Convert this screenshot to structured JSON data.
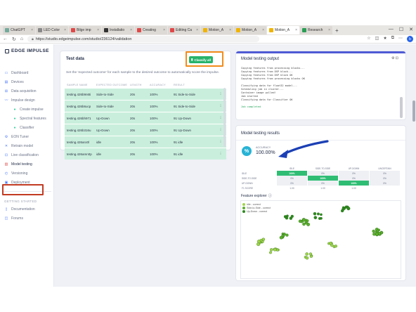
{
  "browser": {
    "tabs": [
      {
        "label": "ChatGPT",
        "color": "#74aa9c",
        "active": false
      },
      {
        "label": "LED Color",
        "color": "#888888",
        "active": false
      },
      {
        "label": "Bilge imp",
        "color": "#e04848",
        "active": false
      },
      {
        "label": "Installatio",
        "color": "#333333",
        "active": false
      },
      {
        "label": "Creating",
        "color": "#e04848",
        "active": false
      },
      {
        "label": "Editing Ca",
        "color": "#e04848",
        "active": false
      },
      {
        "label": "Motion_A",
        "color": "#f0b400",
        "active": false
      },
      {
        "label": "Motion_A",
        "color": "#f0b400",
        "active": false
      },
      {
        "label": "Motion_A",
        "color": "#f0b400",
        "active": true
      },
      {
        "label": "Research",
        "color": "#2a9d55",
        "active": false
      }
    ],
    "url": "https://studio.edgeimpulse.com/studio/236124/validation",
    "controls": {
      "minimize": "—",
      "maximize": "☐",
      "close": "✕"
    }
  },
  "sidebar": {
    "logo": "EDGE IMPULSE",
    "items": [
      {
        "label": "Dashboard",
        "icon": "▭",
        "name": "dashboard"
      },
      {
        "label": "Devices",
        "icon": "▤",
        "name": "devices"
      },
      {
        "label": "Data acquisition",
        "icon": "⊞",
        "name": "data-acquisition"
      },
      {
        "label": "Impulse design",
        "icon": "〰",
        "name": "impulse-design"
      }
    ],
    "sub_items": [
      {
        "label": "Create impulse",
        "name": "create-impulse"
      },
      {
        "label": "Spectral features",
        "name": "spectral-features"
      },
      {
        "label": "Classifier",
        "name": "classifier"
      }
    ],
    "items2": [
      {
        "label": "EON Tuner",
        "icon": "⚙",
        "name": "eon-tuner"
      },
      {
        "label": "Retrain model",
        "icon": "✕",
        "name": "retrain-model"
      },
      {
        "label": "Live classification",
        "icon": "⊡",
        "name": "live-classification"
      },
      {
        "label": "Model testing",
        "icon": "▥",
        "name": "model-testing",
        "active": true
      },
      {
        "label": "Versioning",
        "icon": "◴",
        "name": "versioning"
      },
      {
        "label": "Deployment",
        "icon": "▣",
        "name": "deployment"
      }
    ],
    "section_title": "GETTING STARTED",
    "items3": [
      {
        "label": "Documentation",
        "icon": "▯",
        "name": "documentation"
      },
      {
        "label": "Forums",
        "icon": "◫",
        "name": "forums"
      }
    ]
  },
  "test_data": {
    "title": "Test data",
    "classify_label": "Classify all",
    "description": "Set the 'expected outcome' for each sample to the desired outcome to automatically score the impulse.",
    "columns": [
      "SAMPLE NAME",
      "EXPECTED OUTCOME",
      "LENGTH",
      "ACCURACY",
      "RESULT"
    ],
    "rows": [
      {
        "name": "testing.426b9n6ti",
        "expected": "Side-to-Side",
        "length": "20s",
        "accuracy": "100%",
        "result": "91 Side-to-Side"
      },
      {
        "name": "testing.426b6ucp",
        "expected": "Side-to-Side",
        "length": "20s",
        "accuracy": "100%",
        "result": "91 Side-to-Side"
      },
      {
        "name": "testing.426bh971",
        "expected": "Up-Down",
        "length": "20s",
        "accuracy": "100%",
        "result": "91 Up-Down"
      },
      {
        "name": "testing.426b316u",
        "expected": "Up-Down",
        "length": "20s",
        "accuracy": "100%",
        "result": "91 Up-Down"
      },
      {
        "name": "testing.426aro0l",
        "expected": "idle",
        "length": "20s",
        "accuracy": "100%",
        "result": "91 idle"
      },
      {
        "name": "testing.426amn0p",
        "expected": "idle",
        "length": "20s",
        "accuracy": "100%",
        "result": "91 idle"
      }
    ]
  },
  "output": {
    "title": "Model testing output",
    "tools": "⚙ ⊡",
    "log": [
      "Copying features from processing blocks...",
      "Copying features from DSP block...",
      "Copying features from DSP block OK",
      "Copying features from processing blocks OK",
      "",
      "Classifying data for float32 model...",
      "Scheduling job in cluster...",
      "Container image pulled!",
      "Job started",
      "Classifying data for Classifier OK",
      "",
      "Job completed"
    ]
  },
  "results": {
    "title": "Model testing results",
    "accuracy_label": "ACCURACY",
    "accuracy_value": "100.00%",
    "matrix": {
      "columns": [
        "IDLE",
        "SIDE-TO-SIDE",
        "UP-DOWN",
        "UNCERTAIN"
      ],
      "rows": [
        {
          "label": "IDLE",
          "cells": [
            "100%",
            "0%",
            "0%",
            "0%"
          ],
          "diag": 0
        },
        {
          "label": "SIDE-TO-SIDE",
          "cells": [
            "0%",
            "100%",
            "0%",
            "0%"
          ],
          "diag": 1
        },
        {
          "label": "UP-DOWN",
          "cells": [
            "0%",
            "0%",
            "100%",
            "0%"
          ],
          "diag": 2
        },
        {
          "label": "F1 SCORE",
          "cells": [
            "1.00",
            "1.00",
            "1.00",
            ""
          ],
          "diag": -1
        }
      ]
    },
    "feature_explorer": {
      "title": "Feature explorer",
      "legend": [
        {
          "label": "idle - correct",
          "color": "#9fd44a"
        },
        {
          "label": "Side-to-Side - correct",
          "color": "#5cae2d"
        },
        {
          "label": "Up-Down - correct",
          "color": "#2e8a1e"
        }
      ]
    }
  },
  "colors": {
    "accent": "#4f5bd5",
    "success": "#26b36b",
    "row_bg": "#c9efdc",
    "highlight_red": "#c23b22",
    "highlight_orange": "#f28c1b",
    "arrow": "#1b3fb5"
  }
}
